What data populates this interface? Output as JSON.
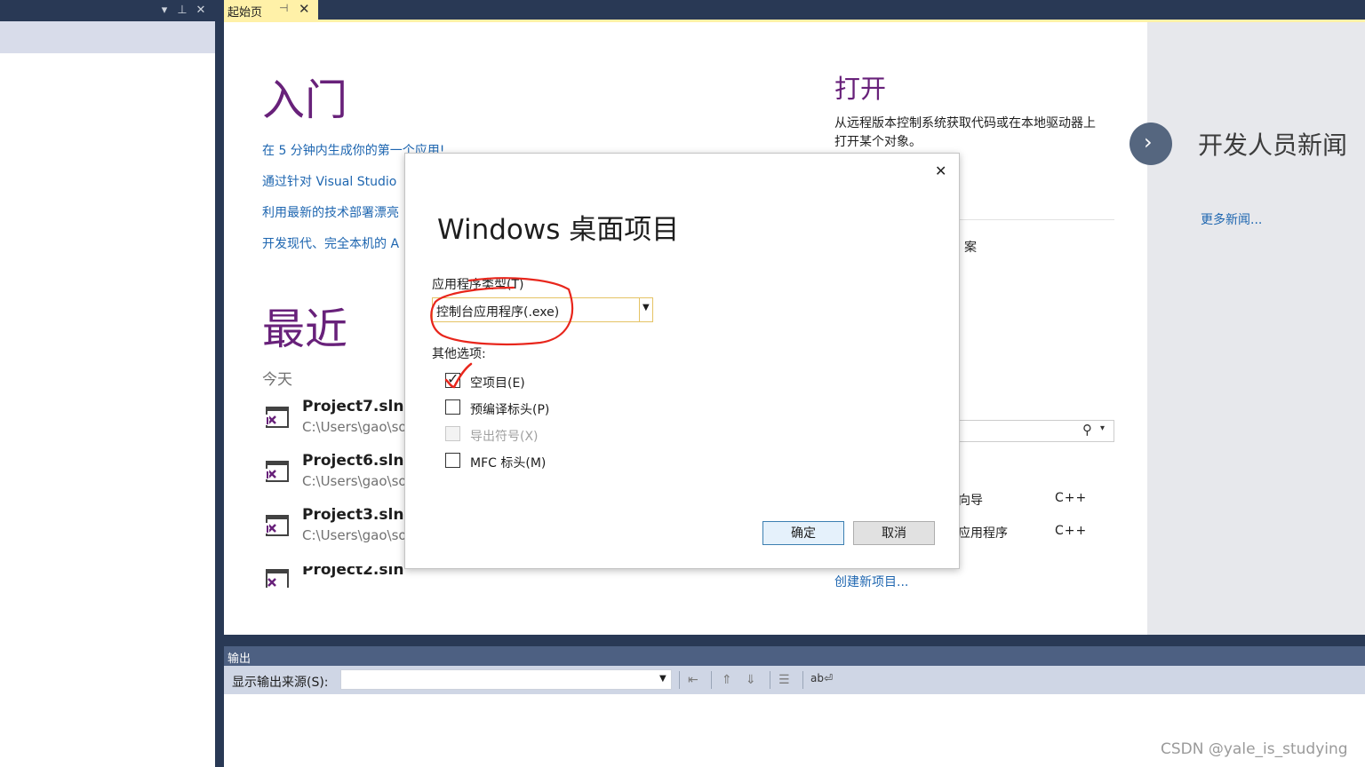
{
  "tab": {
    "label": "起始页",
    "pin": "⊣",
    "close": "✕"
  },
  "start": {
    "get_started": {
      "title": "入门",
      "links": [
        "在 5 分钟内生成你的第一个应用!",
        "通过针对 Visual Studio",
        "利用最新的技术部署漂亮",
        "开发现代、完全本机的 A"
      ]
    },
    "recent": {
      "title": "最近",
      "today": "今天",
      "items": [
        {
          "name": "Project7.sln",
          "path": "C:\\Users\\gao\\so"
        },
        {
          "name": "Project6.sln",
          "path": "C:\\Users\\gao\\so"
        },
        {
          "name": "Project3.sln",
          "path": "C:\\Users\\gao\\so"
        },
        {
          "name": "Project2.sln",
          "path": ""
        }
      ]
    },
    "open": {
      "title": "打开",
      "desc_line1": "从远程版本控制系统获取代码或在本地驱动器上",
      "desc_line2": "打开某个对象。",
      "partial_item": "案"
    },
    "new_project": {
      "rows": [
        {
          "name": "向导",
          "lang": "C++"
        },
        {
          "name": "应用程序",
          "lang": "C++"
        }
      ],
      "create_link": "创建新项目..."
    },
    "news": {
      "title": "开发人员新闻",
      "more": "更多新闻..."
    }
  },
  "dialog": {
    "title": "Windows 桌面项目",
    "close": "✕",
    "app_type_label": "应用程序类型(T)",
    "app_type_value": "控制台应用程序(.exe)",
    "other_label": "其他选项:",
    "options": [
      {
        "label": "空项目(E)",
        "checked": true,
        "disabled": false
      },
      {
        "label": "预编译标头(P)",
        "checked": false,
        "disabled": false
      },
      {
        "label": "导出符号(X)",
        "checked": false,
        "disabled": true
      },
      {
        "label": "MFC 标头(M)",
        "checked": false,
        "disabled": false
      }
    ],
    "ok": "确定",
    "cancel": "取消"
  },
  "output": {
    "title": "输出",
    "source_label": "显示输出来源(S):",
    "source_value": ""
  },
  "watermark": "CSDN @yale_is_studying",
  "colors": {
    "accent_purple": "#68217a",
    "link_blue": "#1e66b0",
    "chrome_dark": "#293955",
    "tab_active": "#fff1a8",
    "annotation_red": "#e8261c"
  }
}
